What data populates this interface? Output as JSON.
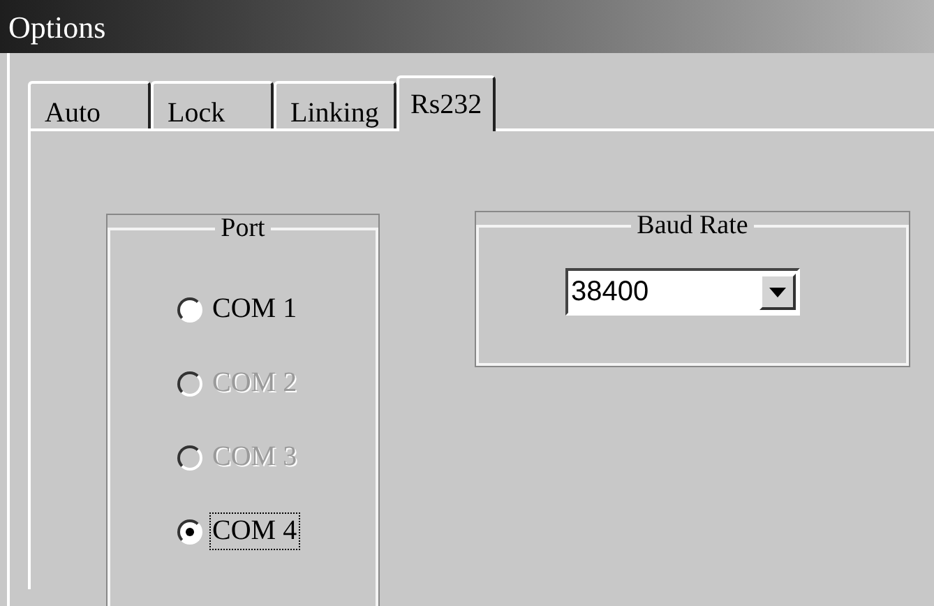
{
  "window": {
    "title": "Options"
  },
  "tabs": [
    {
      "label": "Auto",
      "selected": false
    },
    {
      "label": "Lock",
      "selected": false
    },
    {
      "label": "Linking",
      "selected": false
    },
    {
      "label": "Rs232",
      "selected": true
    }
  ],
  "port": {
    "legend": "Port",
    "options": [
      {
        "label": "COM 1",
        "selected": false,
        "disabled": false,
        "focused": false
      },
      {
        "label": "COM 2",
        "selected": false,
        "disabled": true,
        "focused": false
      },
      {
        "label": "COM 3",
        "selected": false,
        "disabled": true,
        "focused": false
      },
      {
        "label": "COM 4",
        "selected": true,
        "disabled": false,
        "focused": true
      }
    ]
  },
  "baud_rate": {
    "legend": "Baud Rate",
    "value": "38400"
  }
}
